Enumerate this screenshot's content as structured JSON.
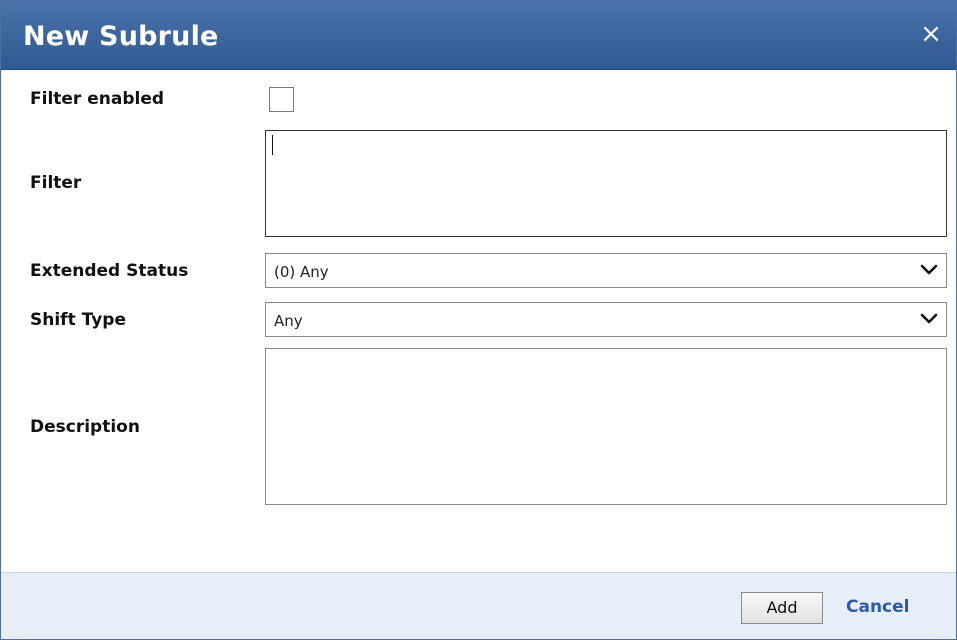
{
  "dialog": {
    "title": "New Subrule",
    "close_label": "×"
  },
  "form": {
    "filter_enabled": {
      "label": "Filter enabled",
      "checked": false
    },
    "filter": {
      "label": "Filter",
      "value": ""
    },
    "extended_status": {
      "label": "Extended Status",
      "selected": "(0) Any"
    },
    "shift_type": {
      "label": "Shift Type",
      "selected": "Any"
    },
    "description": {
      "label": "Description",
      "value": ""
    }
  },
  "footer": {
    "add_label": "Add",
    "cancel_label": "Cancel"
  },
  "colors": {
    "titlebar": "#3f679f",
    "footer_bg": "#e8eef8",
    "link": "#2a5bb0"
  }
}
